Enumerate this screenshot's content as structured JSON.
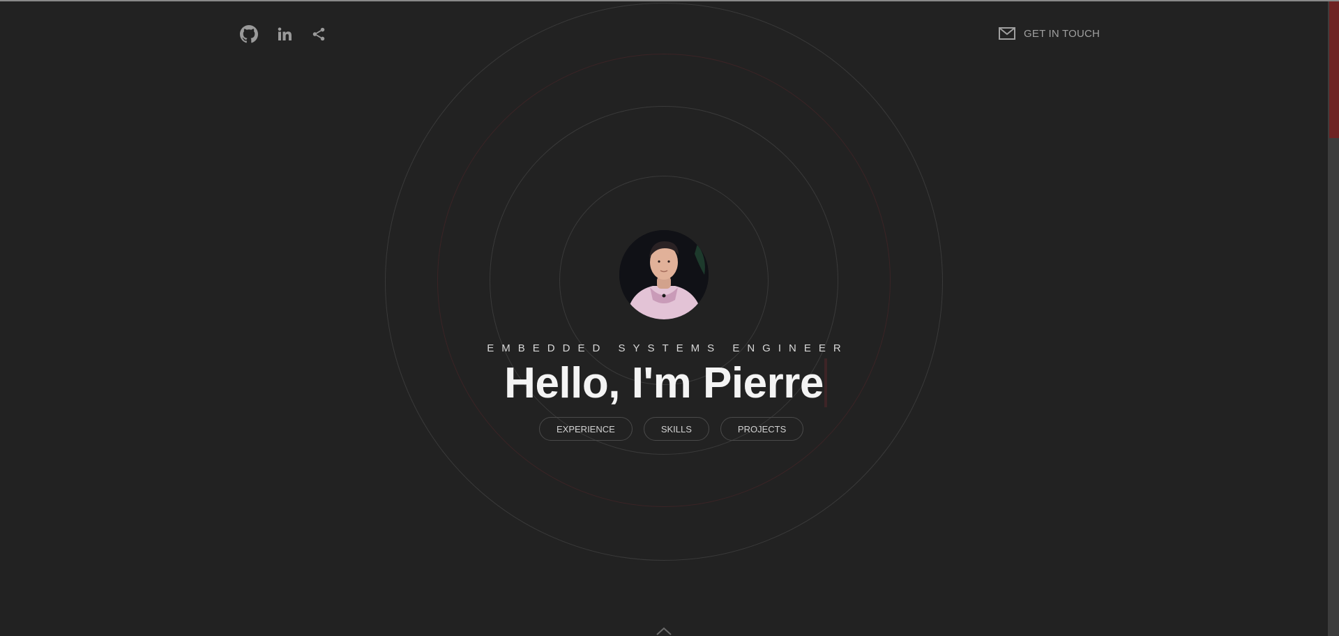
{
  "header": {
    "social": [
      {
        "name": "github",
        "icon": "github-icon"
      },
      {
        "name": "linkedin",
        "icon": "linkedin-icon"
      },
      {
        "name": "share",
        "icon": "share-icon"
      }
    ],
    "contact": {
      "label": "GET IN TOUCH",
      "icon": "mail-icon"
    }
  },
  "hero": {
    "avatar_alt": "Profile photo",
    "subtitle": "EMBEDDED SYSTEMS ENGINEER",
    "headline": "Hello, I'm Pierre",
    "nav": [
      {
        "label": "EXPERIENCE"
      },
      {
        "label": "SKILLS"
      },
      {
        "label": "PROJECTS"
      }
    ]
  },
  "footer": {
    "scroll_icon": "chevron-up-icon"
  },
  "colors": {
    "background": "#222222",
    "ring": "#3a3a3a",
    "accent_ring": "#3b2426",
    "text": "#f4f4f4",
    "muted": "#9a9a9a",
    "scrollbar_thumb": "#6e2323"
  }
}
